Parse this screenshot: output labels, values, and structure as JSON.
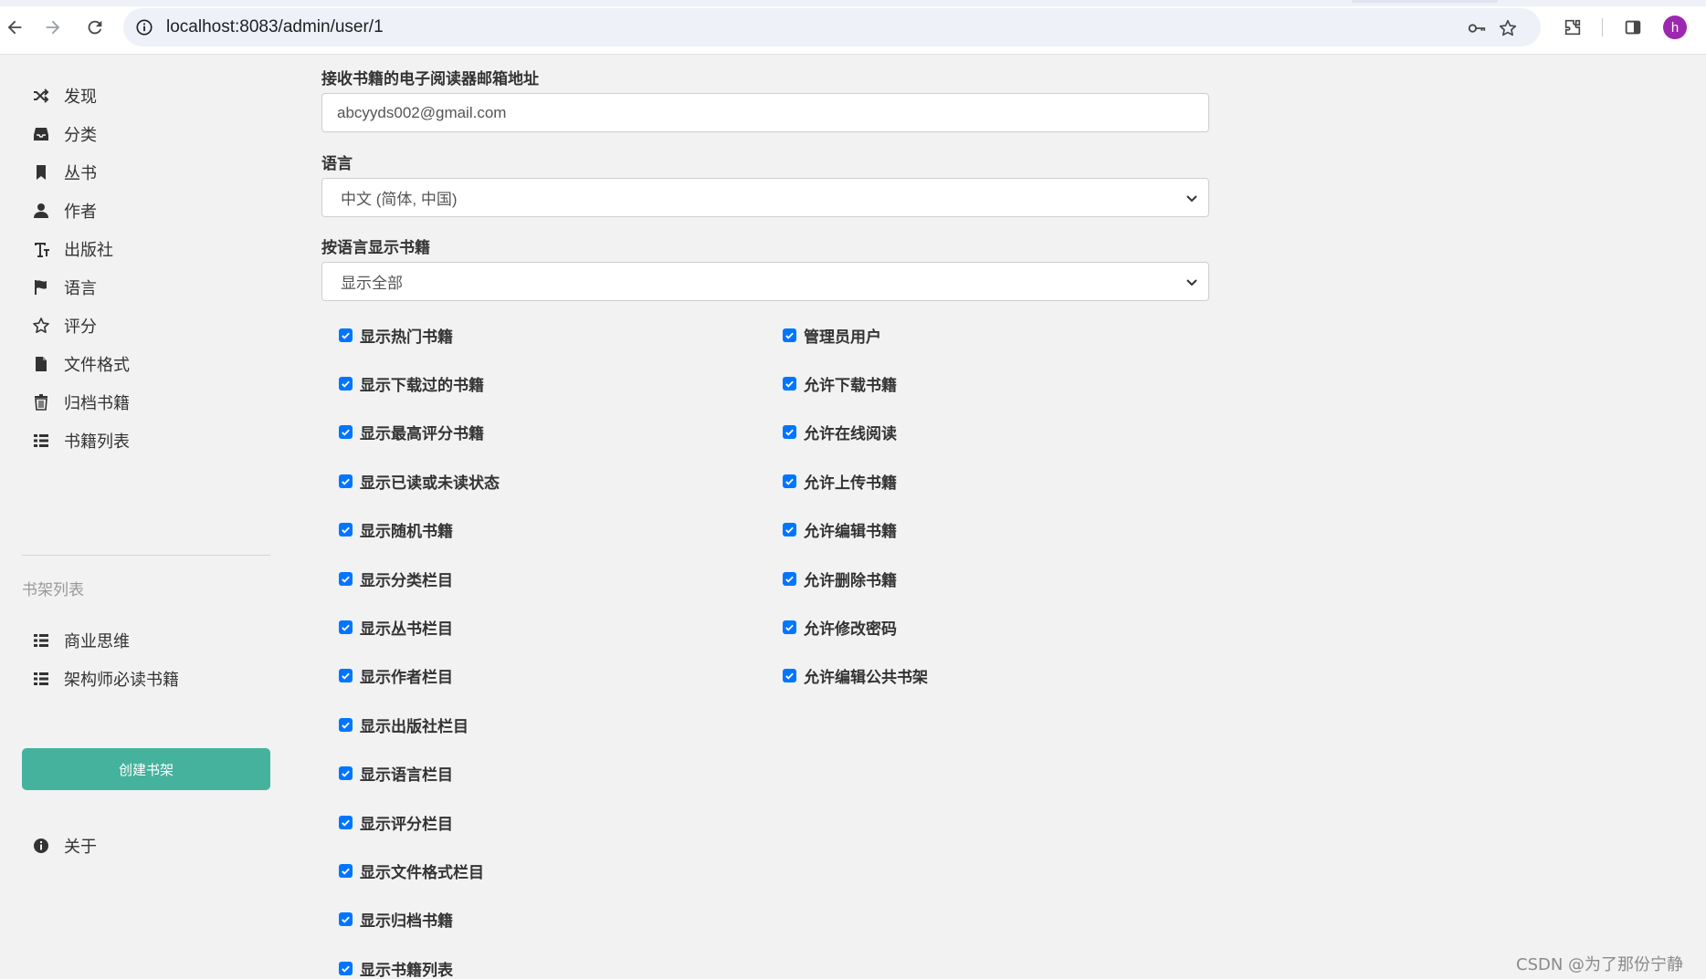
{
  "browser": {
    "url": "localhost:8083/admin/user/1",
    "avatar_letter": "h",
    "accent": "#9c27b0"
  },
  "sidebar": {
    "items": [
      {
        "label": "发现",
        "icon": "shuffle-icon"
      },
      {
        "label": "分类",
        "icon": "inbox-icon"
      },
      {
        "label": "丛书",
        "icon": "bookmark-icon"
      },
      {
        "label": "作者",
        "icon": "user-icon"
      },
      {
        "label": "出版社",
        "icon": "text-size-icon"
      },
      {
        "label": "语言",
        "icon": "flag-icon"
      },
      {
        "label": "评分",
        "icon": "star-icon"
      },
      {
        "label": "文件格式",
        "icon": "file-icon"
      },
      {
        "label": "归档书籍",
        "icon": "trash-icon"
      },
      {
        "label": "书籍列表",
        "icon": "list-icon"
      }
    ],
    "shelves_heading": "书架列表",
    "shelves": [
      {
        "label": "商业思维",
        "icon": "list-icon"
      },
      {
        "label": "架构师必读书籍",
        "icon": "list-icon"
      }
    ],
    "create_shelf": "创建书架",
    "about": "关于",
    "button_color": "#45b29d"
  },
  "form": {
    "email_label": "接收书籍的电子阅读器邮箱地址",
    "email_value": "abcyyds002@gmail.com",
    "language_label": "语言",
    "language_value": "中文 (简体, 中国)",
    "book_language_label": "按语言显示书籍",
    "book_language_value": "显示全部",
    "left_checks": [
      "显示热门书籍",
      "显示下载过的书籍",
      "显示最高评分书籍",
      "显示已读或未读状态",
      "显示随机书籍",
      "显示分类栏目",
      "显示丛书栏目",
      "显示作者栏目",
      "显示出版社栏目",
      "显示语言栏目",
      "显示评分栏目",
      "显示文件格式栏目",
      "显示归档书籍",
      "显示书籍列表"
    ],
    "right_checks": [
      "管理员用户",
      "允许下载书籍",
      "允许在线阅读",
      "允许上传书籍",
      "允许编辑书籍",
      "允许删除书籍",
      "允许修改密码",
      "允许编辑公共书架"
    ],
    "checkbox_color": "#0075ff"
  },
  "watermark": "CSDN @为了那份宁静"
}
